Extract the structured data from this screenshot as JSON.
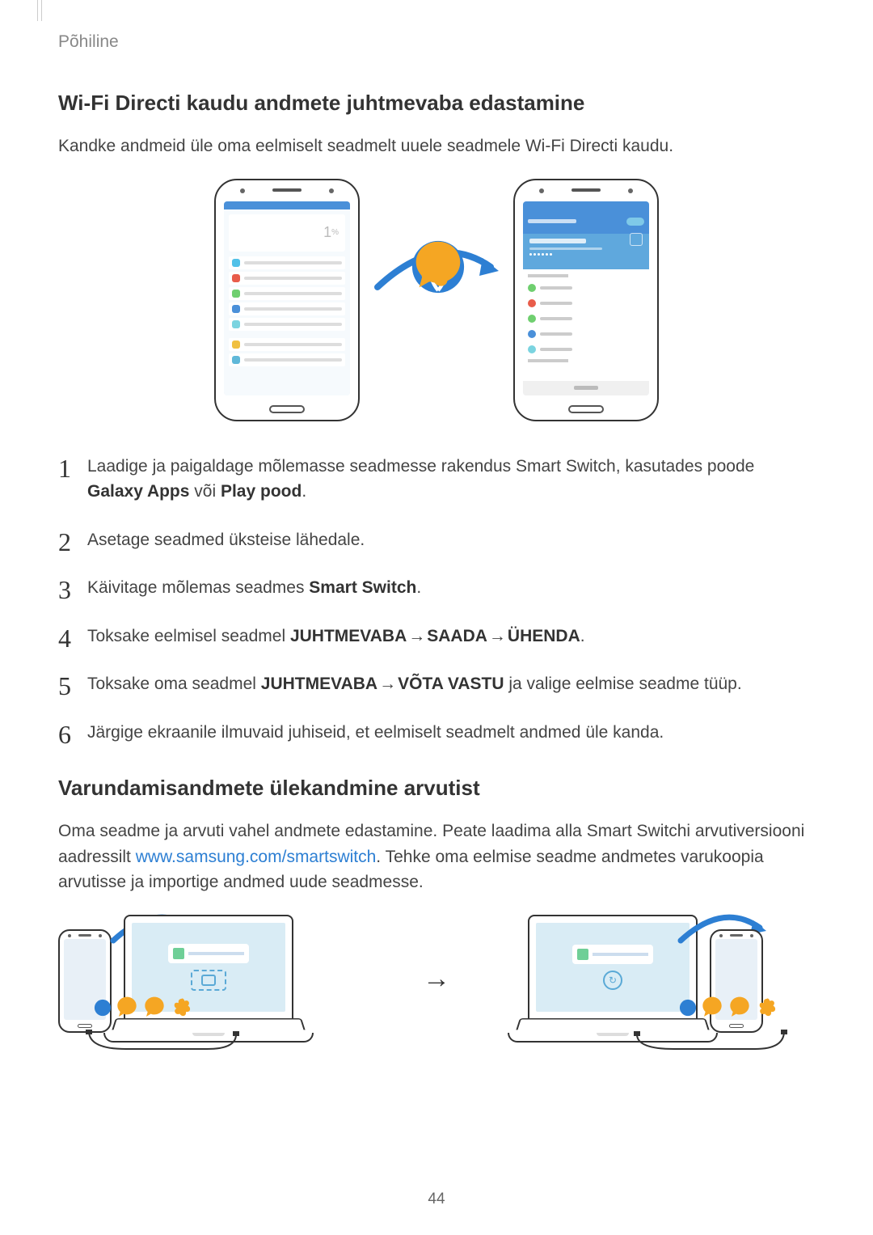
{
  "header": {
    "breadcrumb": "Põhiline"
  },
  "section1": {
    "title": "Wi-Fi Directi kaudu andmete juhtmevaba edastamine",
    "lead": "Kandke andmeid üle oma eelmiselt seadmelt uuele seadmele Wi-Fi Directi kaudu."
  },
  "steps": {
    "s1_a": "Laadige ja paigaldage mõlemasse seadmesse rakendus Smart Switch, kasutades poode ",
    "s1_b1": "Galaxy Apps",
    "s1_b2": " või ",
    "s1_b3": "Play pood",
    "s1_c": ".",
    "s2": "Asetage seadmed üksteise lähedale.",
    "s3_a": "Käivitage mõlemas seadmes ",
    "s3_b": "Smart Switch",
    "s3_c": ".",
    "s4_a": "Toksake eelmisel seadmel ",
    "s4_b1": "JUHTMEVABA",
    "s4_b2": "SAADA",
    "s4_b3": "ÜHENDA",
    "s4_c": ".",
    "s5_a": "Toksake oma seadmel ",
    "s5_b1": "JUHTMEVABA",
    "s5_b2": "VÕTA VASTU",
    "s5_c": " ja valige eelmise seadme tüüp.",
    "s6": "Järgige ekraanile ilmuvaid juhiseid, et eelmiselt seadmelt andmed üle kanda."
  },
  "section2": {
    "title": "Varundamisandmete ülekandmine arvutist",
    "p_a": "Oma seadme ja arvuti vahel andmete edastamine. Peate laadima alla Smart Switchi arvutiversiooni aadressilt ",
    "link_text": "www.samsung.com/smartswitch",
    "p_b": ". Tehke oma eelmise seadme andmetes varukoopia arvutisse ja importige andmed uude seadmesse."
  },
  "arrow": "→",
  "page_number": "44"
}
